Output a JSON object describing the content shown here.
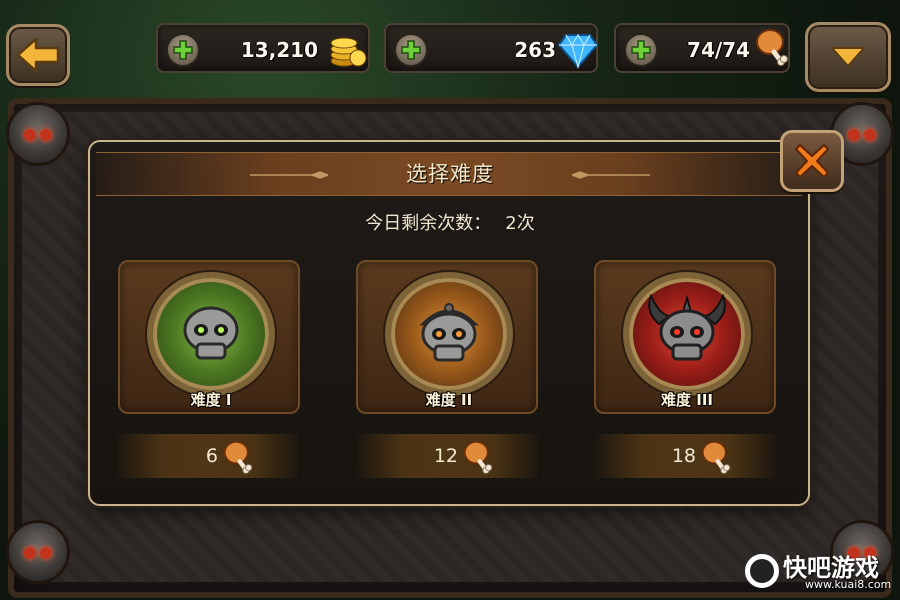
{
  "resources": {
    "gold": {
      "value": "13,210",
      "icon": "gold-coins-icon"
    },
    "diamond": {
      "value": "263",
      "icon": "blue-diamond-icon"
    },
    "stamina": {
      "value": "74/74",
      "icon": "meat-drumstick-icon"
    }
  },
  "dialog": {
    "title": "选择难度",
    "remaining_label": "今日剩余次数：",
    "remaining_value": "2次",
    "difficulties": [
      {
        "label": "难度 I",
        "cost": "6",
        "theme": "green",
        "color": "#4d7a22"
      },
      {
        "label": "难度 II",
        "cost": "12",
        "theme": "orange",
        "color": "#9a5a1a"
      },
      {
        "label": "难度 III",
        "cost": "18",
        "theme": "red",
        "color": "#9c1e18"
      }
    ]
  },
  "watermark": {
    "name": "快吧游戏",
    "url": "www.kuai8.com"
  }
}
